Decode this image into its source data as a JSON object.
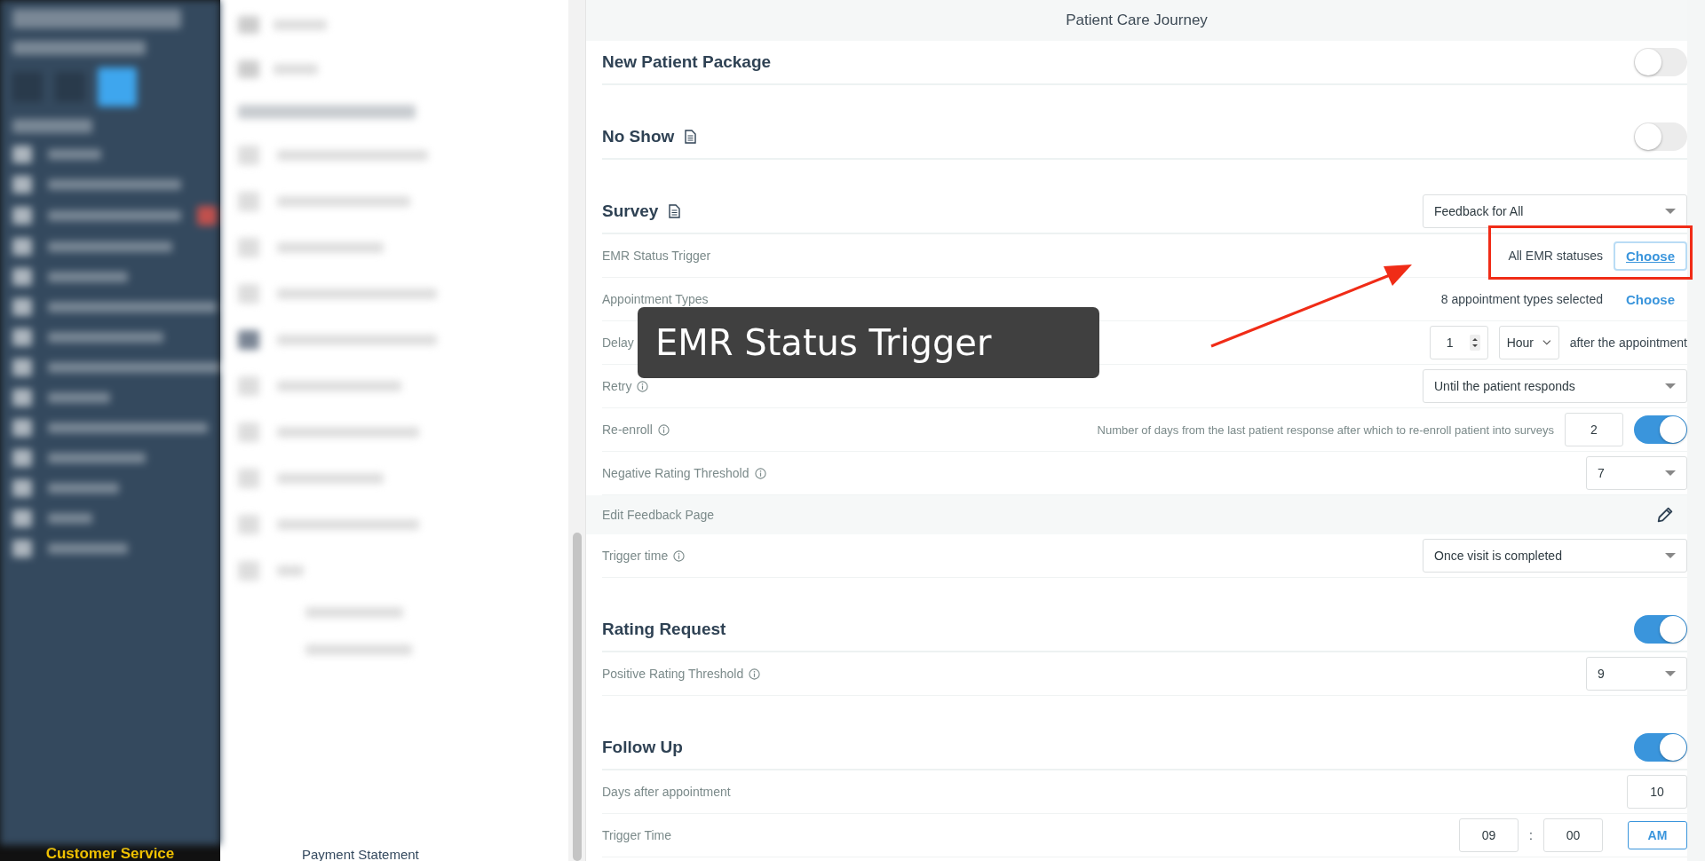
{
  "sidebar": {
    "footer": "Customer Service"
  },
  "subnav": {
    "last_item": "Payment Statement"
  },
  "header": {
    "title": "Patient Care Journey"
  },
  "sections": [
    {
      "title": "New Patient Package",
      "control": {
        "kind": "toggle",
        "on": false
      }
    },
    {
      "title": "No Show",
      "doc_icon": true,
      "control": {
        "kind": "toggle",
        "on": false
      }
    },
    {
      "title": "Survey",
      "doc_icon": true,
      "control": {
        "kind": "select",
        "value": "Feedback for All"
      },
      "rows": [
        {
          "kind": "choose",
          "label": "EMR Status Trigger",
          "summary": "All EMR statuses",
          "action": "Choose",
          "focused": true,
          "annotated": true
        },
        {
          "kind": "choose",
          "label": "Appointment Types",
          "summary": "8 appointment types selected",
          "action": "Choose",
          "focused": false
        },
        {
          "kind": "delay",
          "label": "Delay",
          "amount": "1",
          "unit": "Hour",
          "suffix": "after the appointment"
        },
        {
          "kind": "select",
          "label": "Retry",
          "info": true,
          "value": "Until the patient responds",
          "wide": true
        },
        {
          "kind": "reenroll",
          "label": "Re-enroll",
          "info": true,
          "description": "Number of days from the last patient response after which to re-enroll patient into surveys",
          "value": "2",
          "on": true
        },
        {
          "kind": "select",
          "label": "Negative Rating Threshold",
          "info": true,
          "value": "7",
          "wide": false
        },
        {
          "kind": "edit",
          "label": "Edit Feedback Page"
        },
        {
          "kind": "select",
          "label": "Trigger time",
          "info": true,
          "value": "Once visit is completed",
          "wide": true
        }
      ]
    },
    {
      "title": "Rating Request",
      "control": {
        "kind": "toggle",
        "on": true
      },
      "rows": [
        {
          "kind": "select",
          "label": "Positive Rating Threshold",
          "info": true,
          "value": "9",
          "wide": false
        }
      ]
    },
    {
      "title": "Follow Up",
      "control": {
        "kind": "toggle",
        "on": true
      },
      "rows": [
        {
          "kind": "number",
          "label": "Days after appointment",
          "value": "10"
        },
        {
          "kind": "time",
          "label": "Trigger Time",
          "hour": "09",
          "separator": ":",
          "minute": "00",
          "period": "AM"
        }
      ]
    }
  ],
  "callout": {
    "text": "EMR Status Trigger"
  }
}
